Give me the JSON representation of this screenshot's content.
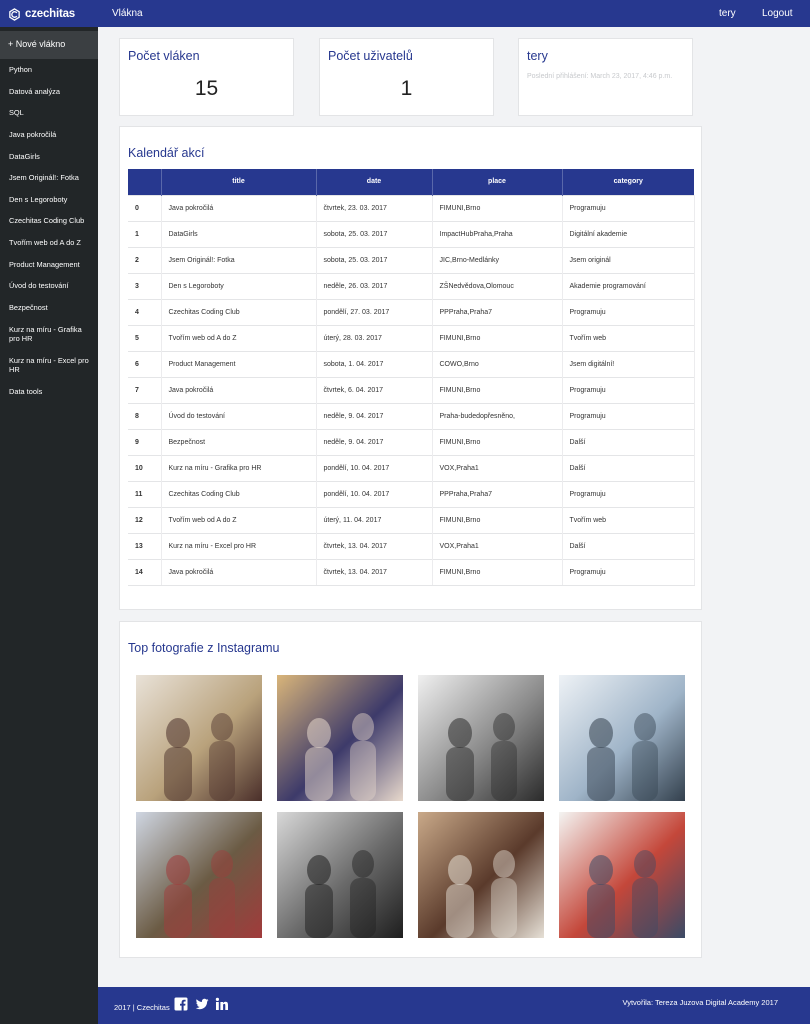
{
  "navbar": {
    "brand": "czechitas",
    "nav_label": "Vlákna",
    "user": "tery",
    "logout": "Logout"
  },
  "sidebar": {
    "new_thread": "+ Nové vlákno",
    "items": [
      "Python",
      "Datová analýza",
      "SQL",
      "Java pokročilá",
      "DataGirls",
      "Jsem Originál!: Fotka",
      "Den s Legoroboty",
      "Czechitas Coding Club",
      "Tvořím web od A do Z",
      "Product Management",
      "Úvod do testování",
      "Bezpečnost",
      "Kurz na míru - Grafika pro HR",
      "Kurz na míru - Excel pro HR",
      "Data tools"
    ]
  },
  "stats": {
    "threads": {
      "label": "Počet vláken",
      "value": "15"
    },
    "users": {
      "label": "Počet uživatelů",
      "value": "1"
    },
    "current_user": {
      "name": "tery",
      "last_login": "Poslední přihlášení: March 23, 2017, 4:46 p.m."
    }
  },
  "calendar": {
    "title": "Kalendář akcí",
    "columns": [
      "",
      "title",
      "date",
      "place",
      "category"
    ],
    "rows": [
      [
        "0",
        "Java pokročilá",
        "čtvrtek, 23. 03. 2017",
        "FIMUNI,Brno",
        "Programuju"
      ],
      [
        "1",
        "DataGirls",
        "sobota, 25. 03. 2017",
        "ImpactHubPraha,Praha",
        "Digitální akademie"
      ],
      [
        "2",
        "Jsem Originál!: Fotka",
        "sobota, 25. 03. 2017",
        "JIC,Brno-Medlánky",
        "Jsem originál"
      ],
      [
        "3",
        "Den s Legoroboty",
        "neděle, 26. 03. 2017",
        "ZŠNedvědova,Olomouc",
        "Akademie programování"
      ],
      [
        "4",
        "Czechitas Coding Club",
        "pondělí, 27. 03. 2017",
        "PPPraha,Praha7",
        "Programuju"
      ],
      [
        "5",
        "Tvořím web od A do Z",
        "úterý, 28. 03. 2017",
        "FIMUNI,Brno",
        "Tvořím web"
      ],
      [
        "6",
        "Product Management",
        "sobota, 1. 04. 2017",
        "COWO,Brno",
        "Jsem digitální!"
      ],
      [
        "7",
        "Java pokročilá",
        "čtvrtek, 6. 04. 2017",
        "FIMUNI,Brno",
        "Programuju"
      ],
      [
        "8",
        "Úvod do testování",
        "neděle, 9. 04. 2017",
        "Praha-budedopřesněno,",
        "Programuju"
      ],
      [
        "9",
        "Bezpečnost",
        "neděle, 9. 04. 2017",
        "FIMUNI,Brno",
        "Další"
      ],
      [
        "10",
        "Kurz na míru - Grafika pro HR",
        "pondělí, 10. 04. 2017",
        "VOX,Praha1",
        "Další"
      ],
      [
        "11",
        "Czechitas Coding Club",
        "pondělí, 10. 04. 2017",
        "PPPraha,Praha7",
        "Programuju"
      ],
      [
        "12",
        "Tvořím web od A do Z",
        "úterý, 11. 04. 2017",
        "FIMUNI,Brno",
        "Tvořím web"
      ],
      [
        "13",
        "Kurz na míru - Excel pro HR",
        "čtvrtek, 13. 04. 2017",
        "VOX,Praha1",
        "Další"
      ],
      [
        "14",
        "Java pokročilá",
        "čtvrtek, 13. 04. 2017",
        "FIMUNI,Brno",
        "Programuju"
      ]
    ]
  },
  "instagram": {
    "title": "Top fotografie z Instagramu",
    "photos": [
      {
        "name": "group-portrait",
        "colors": [
          "#e9e2d8",
          "#b9a27c",
          "#4a2f2a"
        ]
      },
      {
        "name": "woman-with-baby",
        "colors": [
          "#d9b57a",
          "#3d3a6a",
          "#e8d9cc"
        ]
      },
      {
        "name": "conference-room-bw",
        "colors": [
          "#f0f0f0",
          "#8a8a8a",
          "#2b2b2b"
        ]
      },
      {
        "name": "science-park-screen",
        "colors": [
          "#eef2f6",
          "#9fb4c8",
          "#33404d"
        ]
      },
      {
        "name": "parliament-hall",
        "colors": [
          "#cfd6e2",
          "#6b5b44",
          "#a13b3b"
        ]
      },
      {
        "name": "gallery-bw",
        "colors": [
          "#d8d8d8",
          "#6a6a6a",
          "#1e1e1e"
        ]
      },
      {
        "name": "selfie-group",
        "colors": [
          "#c9a989",
          "#5a3a2b",
          "#e6e0d6"
        ]
      },
      {
        "name": "sponsor-wall",
        "colors": [
          "#f4f4f2",
          "#c4473a",
          "#3a4a66"
        ]
      }
    ]
  },
  "footer": {
    "copyright": "2017 | Czechitas",
    "credits": "Vytvořila: Tereza Juzova   Digital Academy 2017"
  },
  "theme": {
    "primary": "#27388f",
    "sidebar_bg": "#222628",
    "page_bg": "#f2f3f5"
  }
}
